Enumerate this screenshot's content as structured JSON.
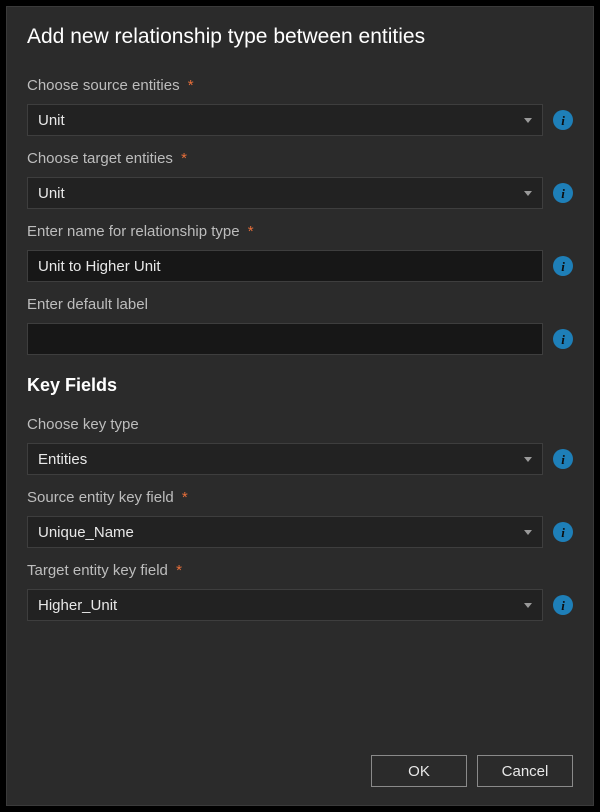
{
  "title": "Add new relationship type between entities",
  "fields": {
    "sourceEntities": {
      "label": "Choose source entities",
      "required": true,
      "value": "Unit"
    },
    "targetEntities": {
      "label": "Choose target entities",
      "required": true,
      "value": "Unit"
    },
    "relName": {
      "label": "Enter name for relationship type",
      "required": true,
      "value": "Unit to Higher Unit"
    },
    "defaultLabel": {
      "label": "Enter default label",
      "required": false,
      "value": ""
    }
  },
  "keyFieldsHeading": "Key Fields",
  "keyFields": {
    "keyType": {
      "label": "Choose key type",
      "required": false,
      "value": "Entities"
    },
    "sourceKey": {
      "label": "Source entity key field",
      "required": true,
      "value": "Unique_Name"
    },
    "targetKey": {
      "label": "Target entity key field",
      "required": true,
      "value": "Higher_Unit"
    }
  },
  "buttons": {
    "ok": "OK",
    "cancel": "Cancel"
  },
  "requiredMark": "*"
}
